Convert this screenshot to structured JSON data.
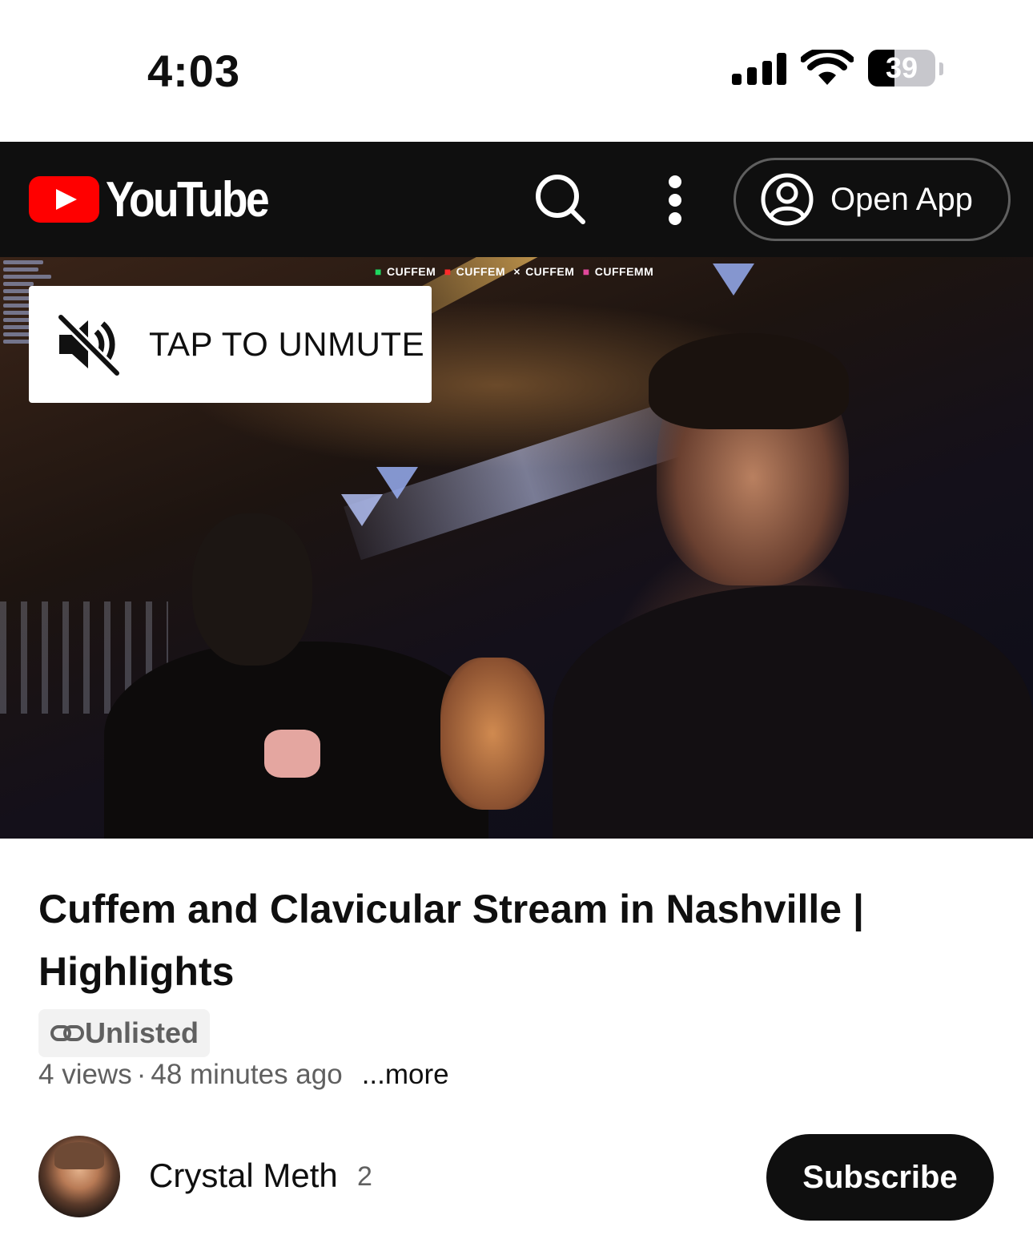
{
  "status_bar": {
    "time": "4:03",
    "battery_level": "39",
    "battery_fraction": 0.39
  },
  "header": {
    "logo_text": "YouTube",
    "search_icon": "search-icon",
    "more_icon": "more-vert-icon",
    "open_app_label": "Open App",
    "colors": {
      "background": "#0f0f0f",
      "brand_red": "#ff0000"
    }
  },
  "player": {
    "overlay_text": [
      "CUFFEM",
      "CUFFEM",
      "CUFFEM",
      "CUFFEMM"
    ],
    "unmute_label": "TAP TO UNMUTE",
    "mute_icon": "volume-off-icon"
  },
  "video": {
    "title": "Cuffem and Clavicular Stream in Nashville | Highlights",
    "visibility_badge": "Unlisted",
    "views": "4 views",
    "separator": "·",
    "uploaded": "48 minutes ago",
    "more_label": "...more"
  },
  "channel": {
    "name": "Crystal Meth",
    "subscriber_count": "2",
    "subscribe_label": "Subscribe"
  }
}
